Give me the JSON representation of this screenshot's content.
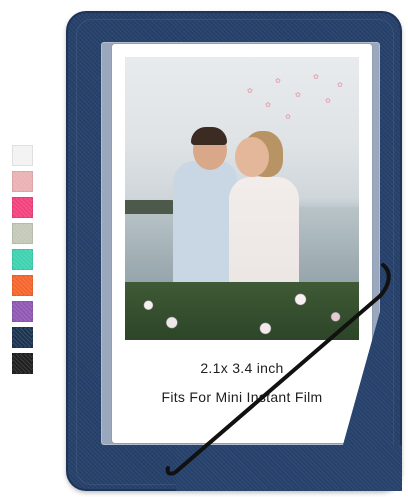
{
  "product": {
    "caption_size": "2.1x 3.4 inch",
    "caption_fits": "Fits For Mini Instant Film",
    "album_color": "#26416b",
    "sleeve_color": "#9aa7bd"
  },
  "swatches": [
    {
      "name": "white",
      "color": "#f2f2f2"
    },
    {
      "name": "light-pink",
      "color": "#ebb2b4"
    },
    {
      "name": "hot-pink",
      "color": "#f2417d"
    },
    {
      "name": "sage-green",
      "color": "#c4cab8"
    },
    {
      "name": "mint",
      "color": "#3ed3b0"
    },
    {
      "name": "orange",
      "color": "#f6662c"
    },
    {
      "name": "purple",
      "color": "#9158b3"
    },
    {
      "name": "navy",
      "color": "#1c3350"
    },
    {
      "name": "black",
      "color": "#202020"
    }
  ]
}
